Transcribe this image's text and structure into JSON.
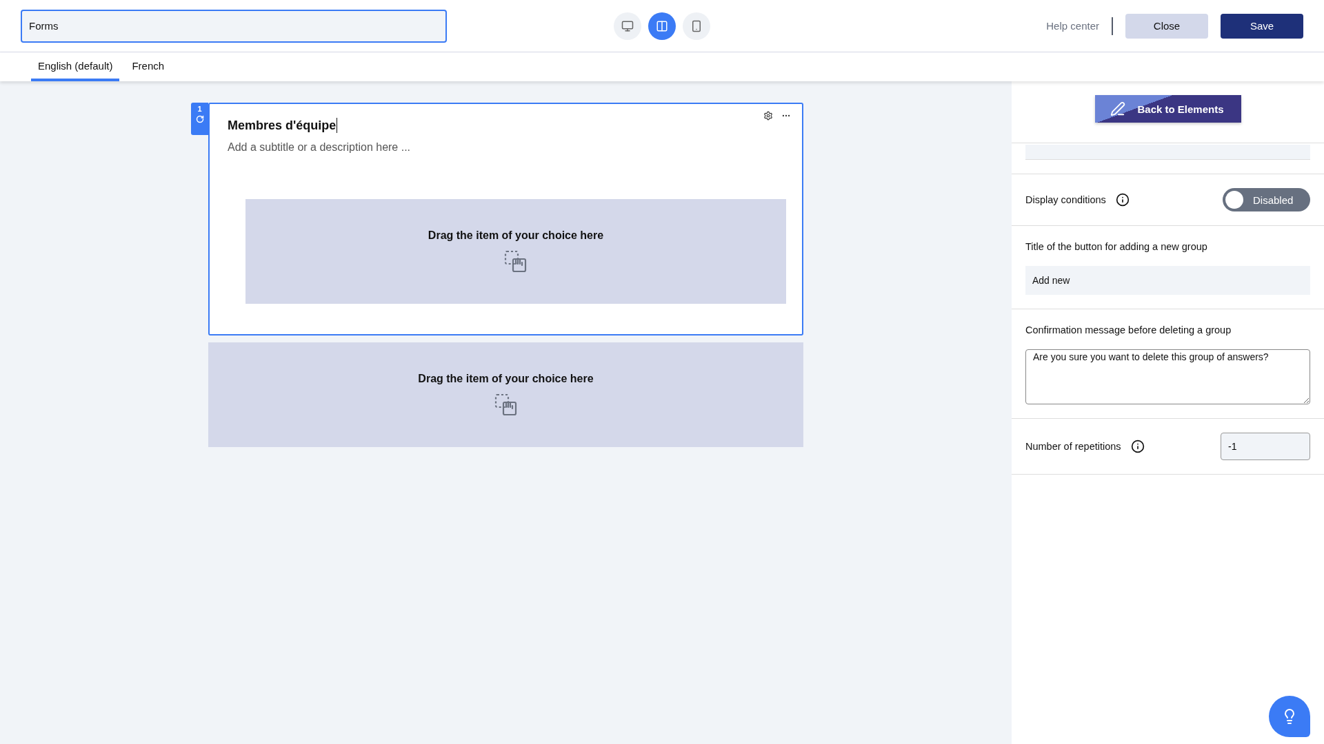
{
  "header": {
    "form_title": "Forms",
    "view_modes": [
      {
        "kind": "desktop",
        "selected": false
      },
      {
        "kind": "split",
        "selected": true
      },
      {
        "kind": "mobile",
        "selected": false
      }
    ],
    "help_link": "Help center",
    "buttons": [
      {
        "kind": "secondary",
        "label": "Close"
      },
      {
        "kind": "primary",
        "label": "Save"
      }
    ]
  },
  "tabs": [
    {
      "label": "English (default)",
      "selected": true
    },
    {
      "label": "French",
      "selected": false
    }
  ],
  "group": {
    "number": "1",
    "title": "Membres d'équipe",
    "subtitle_placeholder": "Add a subtitle or a description here ...",
    "drop_zone": "Drag the item of your choice here"
  },
  "outer_drop_zone": "Drag the item of your choice here",
  "panel": {
    "back_button": "Back to Elements",
    "display_conditions": {
      "label": "Display conditions",
      "on": false,
      "state_label": "Disabled"
    },
    "add_button_title": {
      "label": "Title of the button for adding a new group",
      "value": "Add new"
    },
    "delete_confirmation": {
      "label": "Confirmation message before deleting a group",
      "value": "Are you sure you want to delete this group of answers?"
    },
    "repetitions": {
      "label": "Number of repetitions",
      "value": "-1"
    }
  }
}
